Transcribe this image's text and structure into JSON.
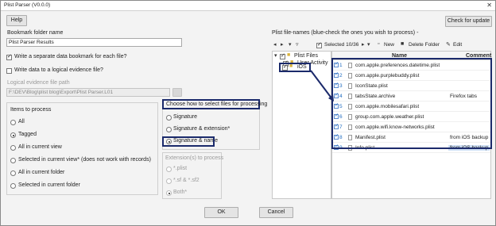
{
  "window": {
    "title": "Plist Parser (V0.0.0)",
    "close_glyph": "✕"
  },
  "header": {
    "help_label": "Help",
    "check_update_label": "Check for update"
  },
  "left": {
    "bookmark_folder_label": "Bookmark folder name",
    "bookmark_folder_value": "Plist Parser Results",
    "write_separate_label": "Write a separate data bookmark for each file?",
    "write_logical_label": "Write data to a logical evidence file?",
    "logical_path_label": "Logical evidence file path",
    "logical_path_value": "F:\\DEV\\Blog\\plist blog\\Export\\Plist Parser.L01",
    "items_title": "Items to process",
    "items": [
      "All",
      "Tagged",
      "All in current view",
      "Selected in current view* (does not work with records)",
      "All in current folder",
      "Selected in current folder"
    ],
    "items_selected": 1
  },
  "middle": {
    "choose_title": "Choose how to select files for processing",
    "choose_options": [
      "Signature",
      "Signature & extension*",
      "Signature & name"
    ],
    "choose_selected": 2,
    "ext_title": "Extension(s) to process",
    "ext_options": [
      "*.plist",
      "*.sf & *.sf2",
      "Both*"
    ],
    "ext_selected": 2
  },
  "right": {
    "list_label": "Plist file-names (blue-check the ones you wish to process) -",
    "toolbar": {
      "selected": "Selected 10/36",
      "new": "New",
      "delete_folder": "Delete Folder",
      "edit": "Edit"
    },
    "tree": {
      "root": "Plist Files",
      "child1": "User Activity",
      "child2": "iOS"
    },
    "columns": {
      "name": "Name",
      "comment": "Comment"
    },
    "rows": [
      {
        "num": "1",
        "name": "com.apple.preferences.datetime.plist",
        "comment": ""
      },
      {
        "num": "2",
        "name": "com.apple.purplebuddy.plist",
        "comment": ""
      },
      {
        "num": "3",
        "name": "IconState.plist",
        "comment": ""
      },
      {
        "num": "4",
        "name": "tabsState.archive",
        "comment": "Firefox tabs"
      },
      {
        "num": "5",
        "name": "com.apple.mobilesafari.plist",
        "comment": ""
      },
      {
        "num": "6",
        "name": "group.com.apple.weather.plist",
        "comment": ""
      },
      {
        "num": "7",
        "name": "com.apple.wifi.know-networks.plist",
        "comment": ""
      },
      {
        "num": "8",
        "name": "Manifest.plist",
        "comment": "from iOS backup"
      },
      {
        "num": "9",
        "name": "Info.plist",
        "comment": "from iOS backup"
      }
    ]
  },
  "footer": {
    "ok_label": "OK",
    "cancel_label": "Cancel"
  },
  "colors": {
    "highlight": "#1b2a6b",
    "selected_row": "#cfe0f5",
    "check_blue": "#1f6bbf"
  }
}
